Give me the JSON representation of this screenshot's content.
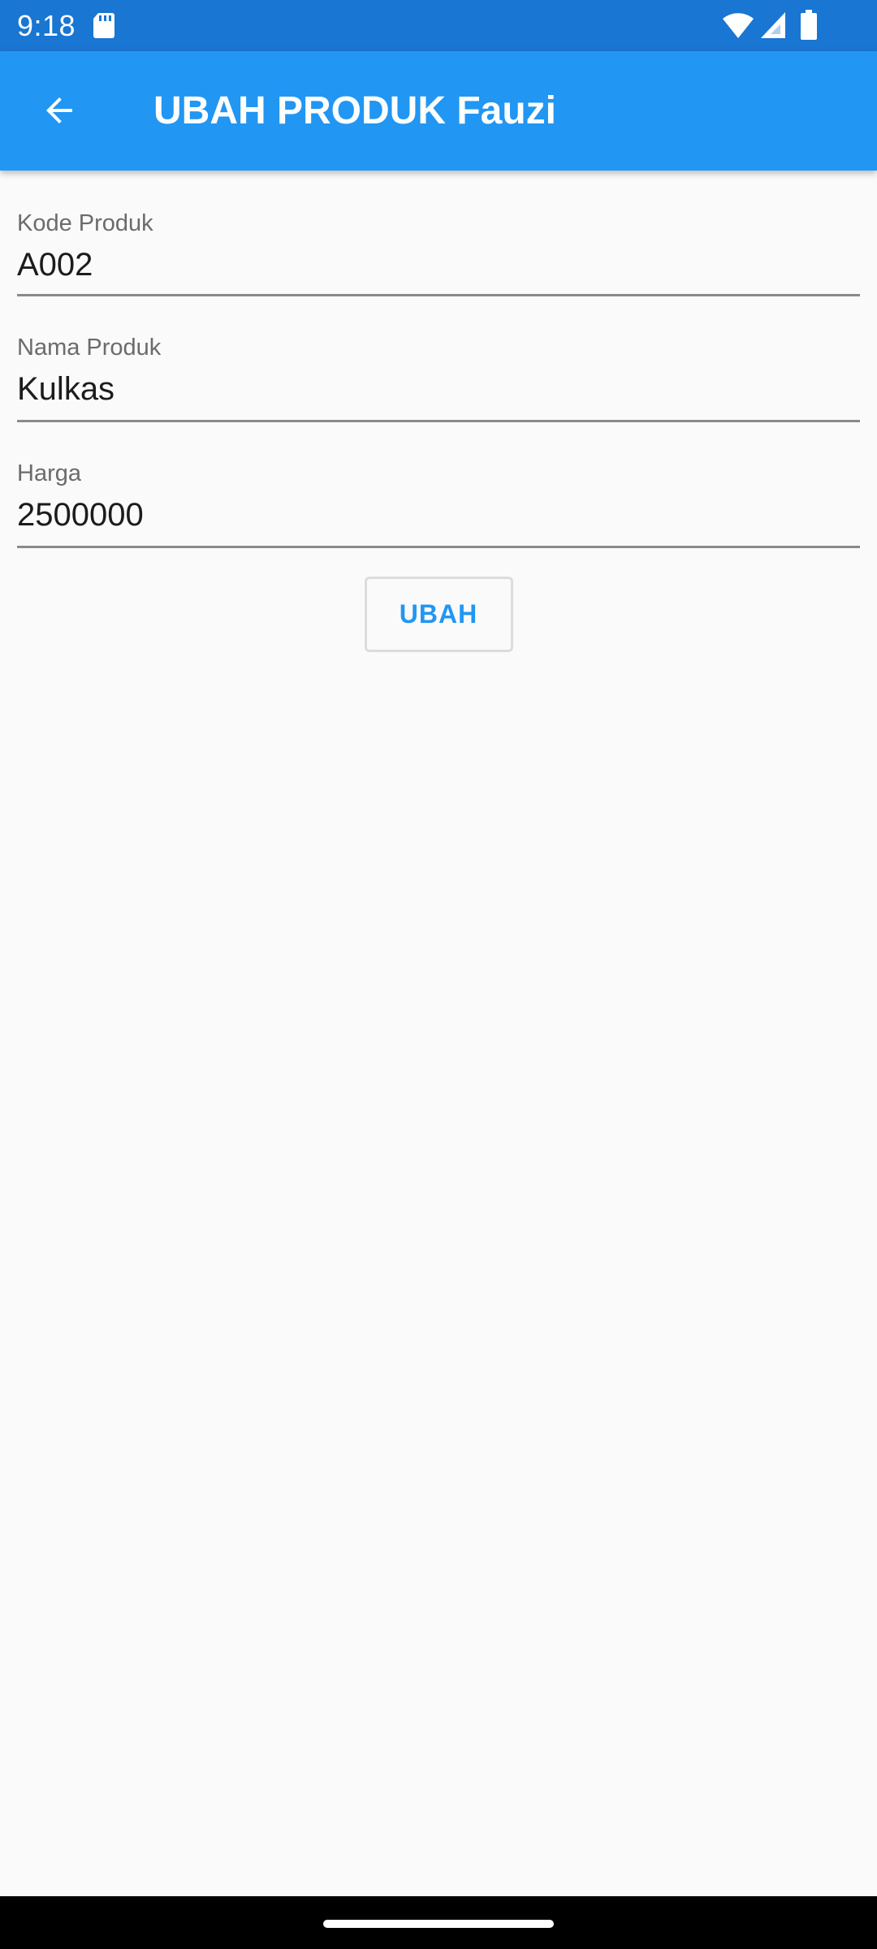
{
  "status_bar": {
    "time": "9:18",
    "icons": [
      "sd-card-icon",
      "wifi-icon",
      "cellular-signal-icon",
      "battery-icon"
    ]
  },
  "app_bar": {
    "back_icon": "arrow-back-icon",
    "title": "UBAH PRODUK Fauzi",
    "color": "#2196f3"
  },
  "form": {
    "fields": [
      {
        "label": "Kode Produk",
        "value": "A002"
      },
      {
        "label": "Nama Produk",
        "value": "Kulkas"
      },
      {
        "label": "Harga",
        "value": "2500000"
      }
    ],
    "submit_label": "UBAH"
  },
  "colors": {
    "status_bar": "#1976d2",
    "app_bar": "#2196f3",
    "background": "#fafafa",
    "accent": "#2196f3"
  }
}
